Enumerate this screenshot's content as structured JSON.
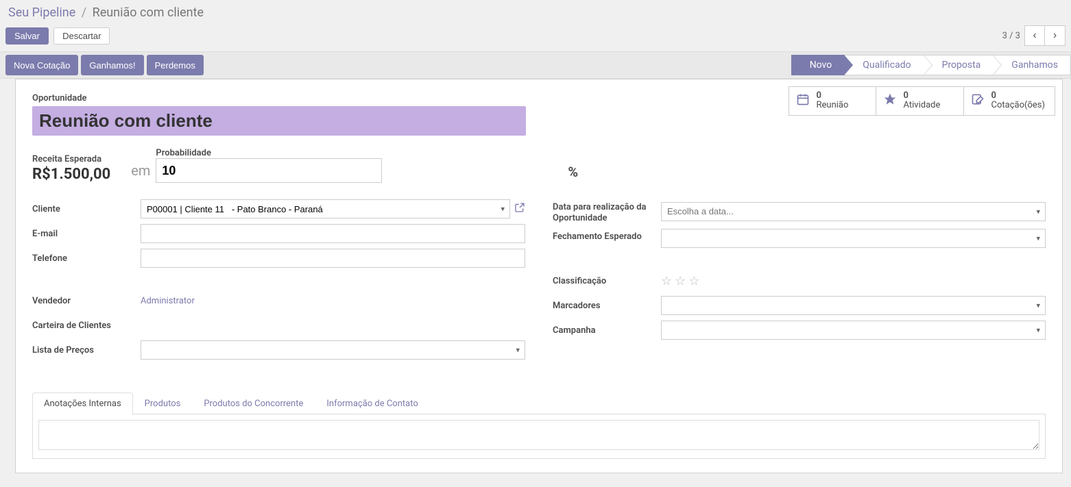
{
  "breadcrumb": {
    "root": "Seu Pipeline",
    "sep": "/",
    "active": "Reunião com cliente"
  },
  "buttons": {
    "save": "Salvar",
    "discard": "Descartar"
  },
  "pager": {
    "text": "3 / 3"
  },
  "status_buttons": {
    "new_quote": "Nova Cotação",
    "won": "Ganhamos!",
    "lost": "Perdemos"
  },
  "stages": {
    "s1": "Novo",
    "s2": "Qualificado",
    "s3": "Proposta",
    "s4": "Ganhamos"
  },
  "stat": {
    "meeting": {
      "count": "0",
      "label": "Reunião"
    },
    "activity": {
      "count": "0",
      "label": "Atividade"
    },
    "quote": {
      "count": "0",
      "label": "Cotação(ões)"
    }
  },
  "form": {
    "opportunity_label": "Oportunidade",
    "title": "Reunião com cliente",
    "expected_revenue_label": "Receita Esperada",
    "expected_revenue": "R$1.500,00",
    "in": "em",
    "probability_label": "Probabilidade",
    "probability": "10",
    "percent": "%",
    "client_label": "Cliente",
    "client_value": "P00001 | Cliente 11   - Pato Branco - Paraná",
    "email_label": "E-mail",
    "email_value": "",
    "phone_label": "Telefone",
    "phone_value": "",
    "salesperson_label": "Vendedor",
    "salesperson_value": "Administrator",
    "portfolio_label": "Carteira de Clientes",
    "pricelist_label": "Lista de Preços",
    "opp_date_label": "Data para realização da Oportunidade",
    "opp_date_placeholder": "Escolha a data...",
    "expected_close_label": "Fechamento Esperado",
    "rating_label": "Classificação",
    "tags_label": "Marcadores",
    "campaign_label": "Campanha"
  },
  "tabs": {
    "t1": "Anotações Internas",
    "t2": "Produtos",
    "t3": "Produtos do Concorrente",
    "t4": "Informação de Contato"
  }
}
